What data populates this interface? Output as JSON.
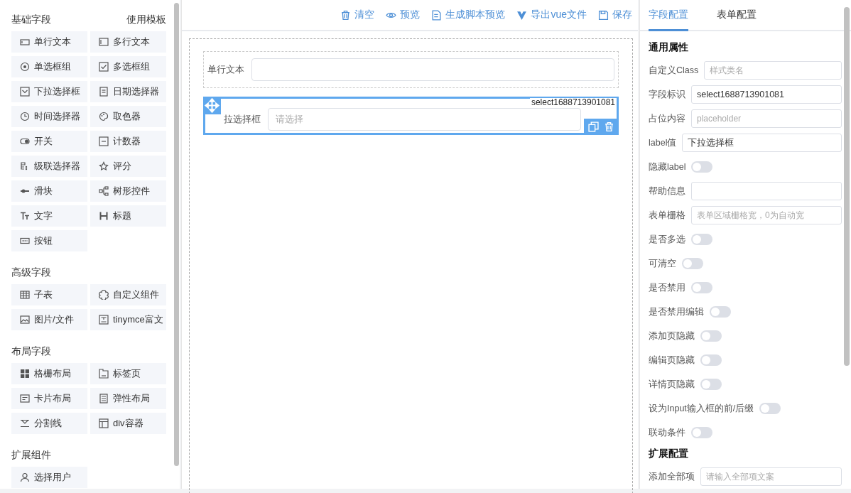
{
  "left_panel": {
    "groups": [
      {
        "title": "基础字段",
        "action": "使用模板",
        "items": [
          "单行文本",
          "多行文本",
          "单选框组",
          "多选框组",
          "下拉选择框",
          "日期选择器",
          "时间选择器",
          "取色器",
          "开关",
          "计数器",
          "级联选择器",
          "评分",
          "滑块",
          "树形控件",
          "文字",
          "标题",
          "按钮"
        ]
      },
      {
        "title": "高级字段",
        "items": [
          "子表",
          "自定义组件",
          "图片/文件",
          "tinymce富文"
        ]
      },
      {
        "title": "布局字段",
        "items": [
          "格栅布局",
          "标签页",
          "卡片布局",
          "弹性布局",
          "分割线",
          "div容器"
        ]
      },
      {
        "title": "扩展组件",
        "items": [
          "选择用户"
        ]
      }
    ]
  },
  "toolbar": {
    "buttons": [
      "清空",
      "预览",
      "生成脚本预览",
      "导出vue文件",
      "保存"
    ]
  },
  "canvas": {
    "fields": [
      {
        "kind": "input",
        "label": "单行文本",
        "selected": false
      },
      {
        "kind": "select",
        "label": "拉选择框",
        "placeholder": "请选择",
        "field_id": "select1688713901081",
        "selected": true
      }
    ]
  },
  "right_panel": {
    "tabs": [
      {
        "label": "字段配置",
        "selected": true
      },
      {
        "label": "表单配置",
        "selected": false
      }
    ],
    "sections": [
      {
        "title": "通用属性",
        "properties": [
          {
            "kind": "input",
            "label": "自定义Class",
            "placeholder": "样式类名"
          },
          {
            "kind": "input",
            "label": "字段标识",
            "value": "select1688713901081"
          },
          {
            "kind": "input",
            "label": "占位内容",
            "placeholder": "placeholder"
          },
          {
            "kind": "input",
            "label": "label值",
            "value": "下拉选择框"
          },
          {
            "kind": "toggle",
            "label": "隐藏label",
            "on": false
          },
          {
            "kind": "input",
            "label": "帮助信息"
          },
          {
            "kind": "input",
            "label": "表单栅格",
            "placeholder": "表单区域栅格宽，0为自动宽"
          },
          {
            "kind": "toggle",
            "label": "是否多选",
            "on": false
          },
          {
            "kind": "toggle",
            "label": "可清空",
            "on": false
          },
          {
            "kind": "toggle",
            "label": "是否禁用",
            "on": false
          },
          {
            "kind": "toggle",
            "label": "是否禁用编辑",
            "on": false
          },
          {
            "kind": "toggle",
            "label": "添加页隐藏",
            "on": false
          },
          {
            "kind": "toggle",
            "label": "编辑页隐藏",
            "on": false
          },
          {
            "kind": "toggle",
            "label": "详情页隐藏",
            "on": false
          },
          {
            "kind": "toggle",
            "label": "设为Input输入框的前/后缀",
            "on": false
          },
          {
            "kind": "toggle",
            "label": "联动条件",
            "on": false
          }
        ]
      },
      {
        "title": "扩展配置",
        "properties": [
          {
            "kind": "input",
            "label": "添加全部项",
            "placeholder": "请输入全部项文案"
          }
        ]
      }
    ]
  }
}
